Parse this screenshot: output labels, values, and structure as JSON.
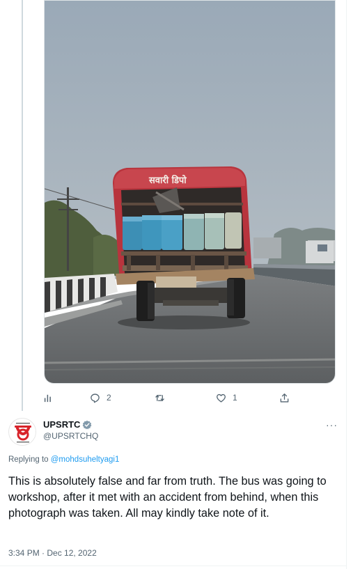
{
  "parent_tweet": {
    "actions": {
      "analytics_label": "",
      "reply_count": "2",
      "retweet_count": "",
      "like_count": "1",
      "share_label": ""
    }
  },
  "reply_tweet": {
    "author_name": "UPSRTC",
    "author_handle": "@UPSRTCHQ",
    "replying_prefix": "Replying to",
    "replying_to": "@mohdsuheltyagi1",
    "text": "This is absolutely false and far from truth. The bus was going to workshop, after it met with an accident from behind, when this photograph was taken. All may kindly take note of it.",
    "timestamp": "3:34 PM · Dec 12, 2022",
    "more_label": "···"
  },
  "colors": {
    "link": "#1d9bf0",
    "secondary_text": "#536471",
    "bus_red": "#b8343d",
    "seat_blue": "#3d8fb5",
    "verified_badge": "#829aab"
  },
  "icons": [
    "analytics-icon",
    "reply-icon",
    "retweet-icon",
    "like-icon",
    "share-icon",
    "verified-badge-icon",
    "upsrtc-logo"
  ]
}
